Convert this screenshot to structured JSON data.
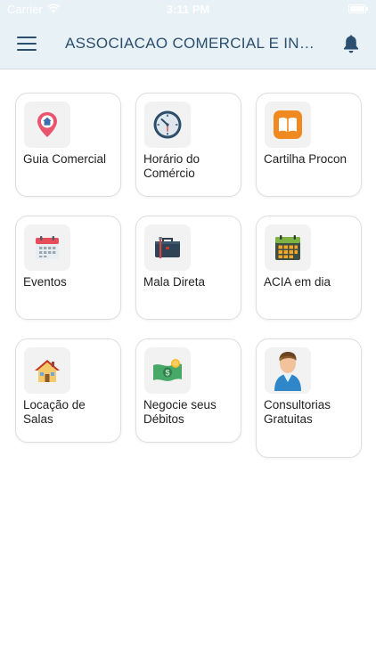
{
  "status_bar": {
    "carrier": "Carrier",
    "time": "3:11 PM",
    "wifi_icon": "wifi-icon",
    "battery_icon": "battery-icon"
  },
  "header": {
    "title": "ASSOCIACAO COMERCIAL E INDUSTRIAL",
    "menu_icon": "hamburger-menu-icon",
    "notification_icon": "bell-icon",
    "background": "#e8f1f6",
    "title_color": "#2b4f6e"
  },
  "grid": {
    "items": [
      {
        "label": "Guia Comercial",
        "icon": "map-pin-home-icon"
      },
      {
        "label": "Horário do Comércio",
        "icon": "clock-icon"
      },
      {
        "label": "Cartilha Procon",
        "icon": "book-icon"
      },
      {
        "label": "Eventos",
        "icon": "calendar-icon"
      },
      {
        "label": "Mala Direta",
        "icon": "briefcase-icon"
      },
      {
        "label": "ACIA em dia",
        "icon": "calendar-grid-icon"
      },
      {
        "label": "Locação de Salas",
        "icon": "house-icon"
      },
      {
        "label": "Negocie seus Débitos",
        "icon": "money-icon"
      },
      {
        "label": "Consultorias Gratuitas",
        "icon": "consultant-person-icon"
      }
    ]
  }
}
